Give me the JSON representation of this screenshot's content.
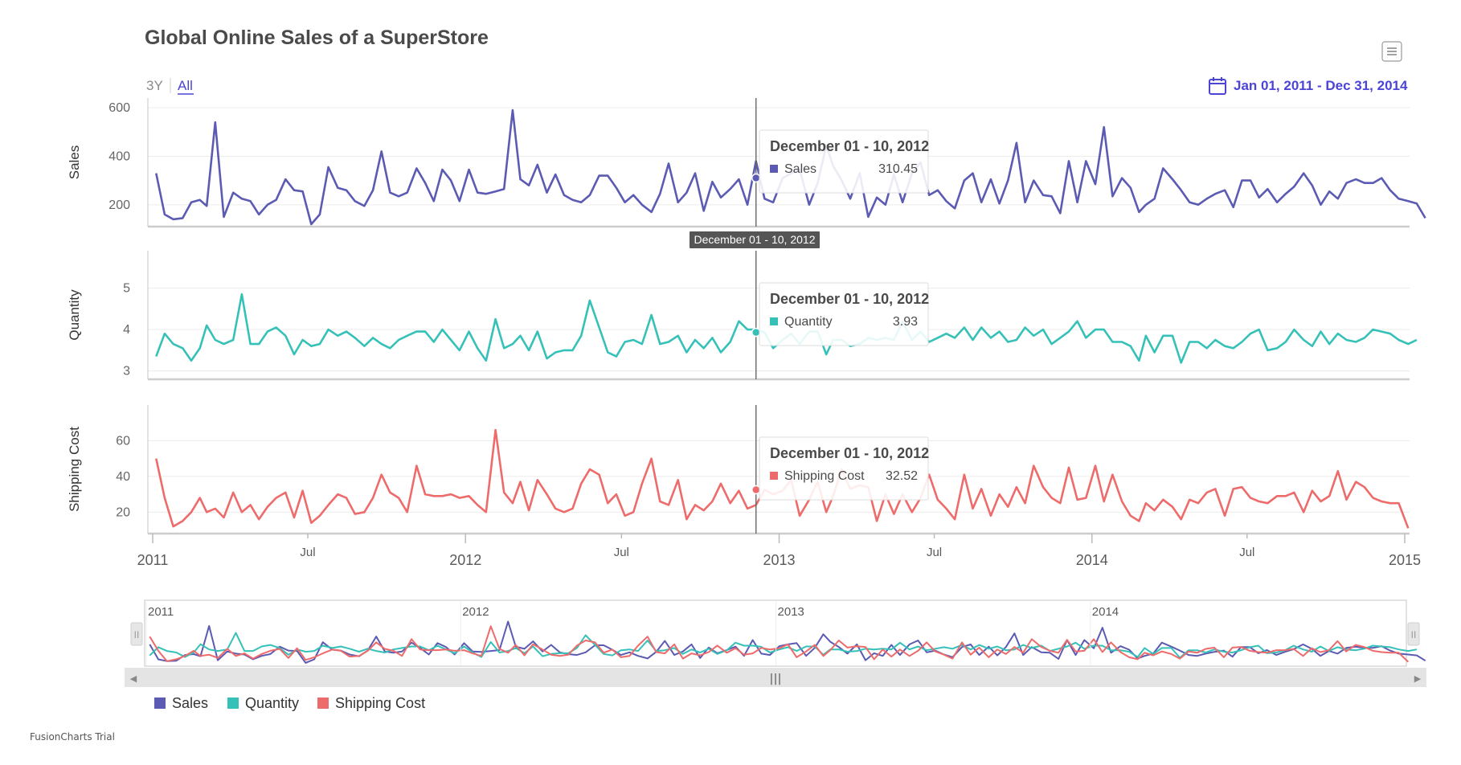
{
  "chart": {
    "title": "Global Online Sales of a SuperStore",
    "range_buttons": [
      "3Y",
      "All"
    ],
    "active_range": "All",
    "date_range": "Jan 01, 2011 - Dec 31, 2014",
    "footer": "FusionCharts Trial",
    "menu_icon": "hamburger-menu-icon",
    "calendar_icon": "calendar-icon"
  },
  "crosshair": {
    "label": "December 01 - 10, 2012",
    "date": "2012-12-05",
    "values": {
      "Sales": "310.45",
      "Quantity": "3.93",
      "Shipping Cost": "32.52"
    }
  },
  "legend": [
    "Sales",
    "Quantity",
    "Shipping Cost"
  ],
  "navigator": {
    "year_labels": [
      "2011",
      "2012",
      "2013",
      "2014"
    ],
    "grip_symbol": "II",
    "thumb_symbol": "|||",
    "left_arrow": "◀",
    "right_arrow": "▶"
  },
  "chart_data": {
    "type": "line",
    "title": "Global Online Sales of a SuperStore",
    "colors": {
      "Sales": "#5b5bb3",
      "Quantity": "#36c1b8",
      "Shipping Cost": "#ee6b6b"
    },
    "x_start": "2011-01-01",
    "x_end": "2014-12-31",
    "x_step": "~10 days (3 points per month)",
    "x_tick_labels": [
      "2011",
      "Jul",
      "2012",
      "Jul",
      "2013",
      "Jul",
      "2014",
      "Jul",
      "2015"
    ],
    "grid": true,
    "legend_position": "bottom-left",
    "series": [
      {
        "name": "Sales",
        "ylabel": "Sales",
        "ylim": [
          110,
          640
        ],
        "y_ticks": [
          200,
          400,
          600
        ],
        "values": [
          330,
          160,
          140,
          145,
          210,
          220,
          195,
          540,
          150,
          250,
          225,
          215,
          160,
          200,
          220,
          305,
          260,
          255,
          120,
          160,
          355,
          270,
          260,
          215,
          195,
          260,
          420,
          250,
          235,
          250,
          350,
          290,
          215,
          345,
          300,
          215,
          345,
          250,
          245,
          255,
          265,
          590,
          305,
          280,
          365,
          250,
          325,
          240,
          220,
          210,
          240,
          320,
          320,
          270,
          210,
          240,
          200,
          170,
          245,
          370,
          210,
          250,
          330,
          175,
          295,
          230,
          265,
          305,
          200,
          380,
          225,
          210,
          310,
          330,
          345,
          200,
          290,
          445,
          360,
          300,
          225,
          330,
          150,
          230,
          200,
          325,
          210,
          330,
          375,
          240,
          260,
          215,
          185,
          300,
          330,
          210,
          305,
          205,
          300,
          455,
          210,
          300,
          240,
          235,
          165,
          380,
          210,
          380,
          285,
          520,
          235,
          310,
          270,
          170,
          200,
          225,
          350,
          305,
          260,
          210,
          200,
          225,
          245,
          260,
          190,
          300,
          300,
          230,
          265,
          210,
          245,
          275,
          330,
          280,
          200,
          255,
          225,
          290,
          305,
          290,
          290,
          310,
          260,
          225,
          215,
          205,
          145
        ]
      },
      {
        "name": "Quantity",
        "ylabel": "Quantity",
        "ylim": [
          2.8,
          5.9
        ],
        "y_ticks": [
          3,
          4,
          5
        ],
        "values": [
          3.35,
          3.9,
          3.65,
          3.55,
          3.25,
          3.55,
          4.1,
          3.75,
          3.65,
          3.75,
          4.85,
          3.65,
          3.65,
          3.95,
          4.05,
          3.85,
          3.4,
          3.75,
          3.6,
          3.65,
          4.0,
          3.85,
          3.95,
          3.8,
          3.6,
          3.8,
          3.65,
          3.55,
          3.75,
          3.85,
          3.95,
          3.95,
          3.7,
          4.0,
          3.75,
          3.5,
          3.95,
          3.55,
          3.25,
          4.25,
          3.55,
          3.65,
          3.85,
          3.5,
          3.95,
          3.3,
          3.45,
          3.5,
          3.5,
          3.85,
          4.7,
          4.05,
          3.45,
          3.35,
          3.7,
          3.75,
          3.65,
          4.35,
          3.65,
          3.7,
          3.85,
          3.45,
          3.75,
          3.55,
          3.8,
          3.45,
          3.7,
          4.2,
          4.0,
          4.0,
          3.93,
          3.55,
          3.75,
          3.9,
          3.65,
          3.95,
          3.95,
          3.4,
          3.75,
          3.75,
          3.6,
          3.65,
          3.8,
          3.75,
          3.8,
          3.75,
          4.2,
          3.75,
          3.95,
          3.7,
          3.8,
          3.9,
          3.8,
          4.05,
          3.75,
          4.05,
          3.8,
          3.95,
          3.7,
          3.75,
          4.05,
          3.85,
          4.0,
          3.65,
          3.8,
          3.95,
          4.2,
          3.8,
          4.0,
          4.0,
          3.7,
          3.7,
          3.6,
          3.25,
          3.85,
          3.45,
          3.85,
          3.85,
          3.2,
          3.7,
          3.7,
          3.55,
          3.75,
          3.6,
          3.55,
          3.7,
          3.9,
          4.0,
          3.5,
          3.55,
          3.7,
          4.0,
          3.75,
          3.6,
          3.95,
          3.65,
          3.9,
          3.75,
          3.7,
          3.8,
          4.0,
          3.95,
          3.9,
          3.75,
          3.65,
          3.75
        ]
      },
      {
        "name": "Shipping Cost",
        "ylabel": "Shipping Cost",
        "ylim": [
          8,
          80
        ],
        "y_ticks": [
          20,
          40,
          60
        ],
        "values": [
          50,
          28,
          12,
          15,
          20,
          28,
          20,
          22,
          17,
          31,
          20,
          24,
          16,
          23,
          28,
          31,
          17,
          32,
          14,
          18,
          24,
          30,
          28,
          19,
          20,
          28,
          41,
          31,
          28,
          20,
          46,
          30,
          29,
          29,
          30,
          28,
          29,
          24,
          20,
          66,
          31,
          25,
          37,
          21,
          38,
          30,
          22,
          20,
          22,
          36,
          44,
          41,
          25,
          30,
          18,
          20,
          36,
          50,
          26,
          24,
          38,
          16,
          24,
          21,
          26,
          36,
          25,
          32,
          22,
          24,
          32.52,
          30,
          32,
          38,
          18,
          27,
          37,
          20,
          29,
          44,
          33,
          35,
          34,
          15,
          30,
          19,
          30,
          20,
          28,
          41,
          27,
          22,
          16,
          41,
          22,
          33,
          18,
          30,
          23,
          34,
          25,
          46,
          34,
          28,
          25,
          45,
          27,
          28,
          46,
          26,
          41,
          26,
          18,
          15,
          25,
          21,
          27,
          23,
          16,
          27,
          25,
          31,
          33,
          18,
          33,
          34,
          28,
          26,
          25,
          29,
          29,
          31,
          20,
          32,
          26,
          29,
          43,
          27,
          37,
          34,
          28,
          26,
          25,
          25,
          11
        ]
      }
    ]
  }
}
